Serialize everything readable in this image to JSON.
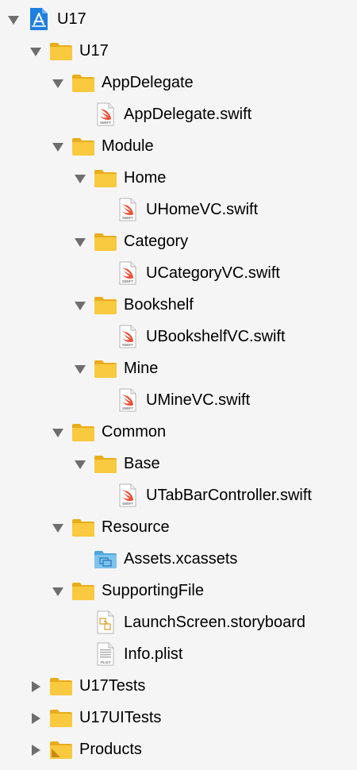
{
  "tree": [
    {
      "label": "U17",
      "type": "project",
      "depth": 0,
      "disclosure": "expanded"
    },
    {
      "label": "U17",
      "type": "folder",
      "depth": 1,
      "disclosure": "expanded"
    },
    {
      "label": "AppDelegate",
      "type": "folder",
      "depth": 2,
      "disclosure": "expanded"
    },
    {
      "label": "AppDelegate.swift",
      "type": "swift",
      "depth": 3,
      "disclosure": "none"
    },
    {
      "label": "Module",
      "type": "folder",
      "depth": 2,
      "disclosure": "expanded"
    },
    {
      "label": "Home",
      "type": "folder",
      "depth": 3,
      "disclosure": "expanded"
    },
    {
      "label": "UHomeVC.swift",
      "type": "swift",
      "depth": 4,
      "disclosure": "none"
    },
    {
      "label": "Category",
      "type": "folder",
      "depth": 3,
      "disclosure": "expanded"
    },
    {
      "label": "UCategoryVC.swift",
      "type": "swift",
      "depth": 4,
      "disclosure": "none"
    },
    {
      "label": "Bookshelf",
      "type": "folder",
      "depth": 3,
      "disclosure": "expanded"
    },
    {
      "label": "UBookshelfVC.swift",
      "type": "swift",
      "depth": 4,
      "disclosure": "none"
    },
    {
      "label": "Mine",
      "type": "folder",
      "depth": 3,
      "disclosure": "expanded"
    },
    {
      "label": "UMineVC.swift",
      "type": "swift",
      "depth": 4,
      "disclosure": "none"
    },
    {
      "label": "Common",
      "type": "folder",
      "depth": 2,
      "disclosure": "expanded"
    },
    {
      "label": "Base",
      "type": "folder",
      "depth": 3,
      "disclosure": "expanded"
    },
    {
      "label": "UTabBarController.swift",
      "type": "swift",
      "depth": 4,
      "disclosure": "none"
    },
    {
      "label": "Resource",
      "type": "folder",
      "depth": 2,
      "disclosure": "expanded"
    },
    {
      "label": "Assets.xcassets",
      "type": "assets",
      "depth": 3,
      "disclosure": "none"
    },
    {
      "label": "SupportingFile",
      "type": "folder",
      "depth": 2,
      "disclosure": "expanded"
    },
    {
      "label": "LaunchScreen.storyboard",
      "type": "storyboard",
      "depth": 3,
      "disclosure": "none"
    },
    {
      "label": "Info.plist",
      "type": "plist",
      "depth": 3,
      "disclosure": "none"
    },
    {
      "label": "U17Tests",
      "type": "folder",
      "depth": 1,
      "disclosure": "collapsed"
    },
    {
      "label": "U17UITests",
      "type": "folder",
      "depth": 1,
      "disclosure": "collapsed"
    },
    {
      "label": "Products",
      "type": "products",
      "depth": 1,
      "disclosure": "collapsed"
    }
  ],
  "icon_text": {
    "swift": "SWIFT",
    "plist": "PLIST"
  },
  "colors": {
    "folder": "#f9c93f",
    "folder_dark": "#e8ad1c",
    "folder_blue": "#7fc3ec",
    "swift": "#f05138",
    "project": "#1f7fe0",
    "disclosure": "#6e6e6e"
  }
}
